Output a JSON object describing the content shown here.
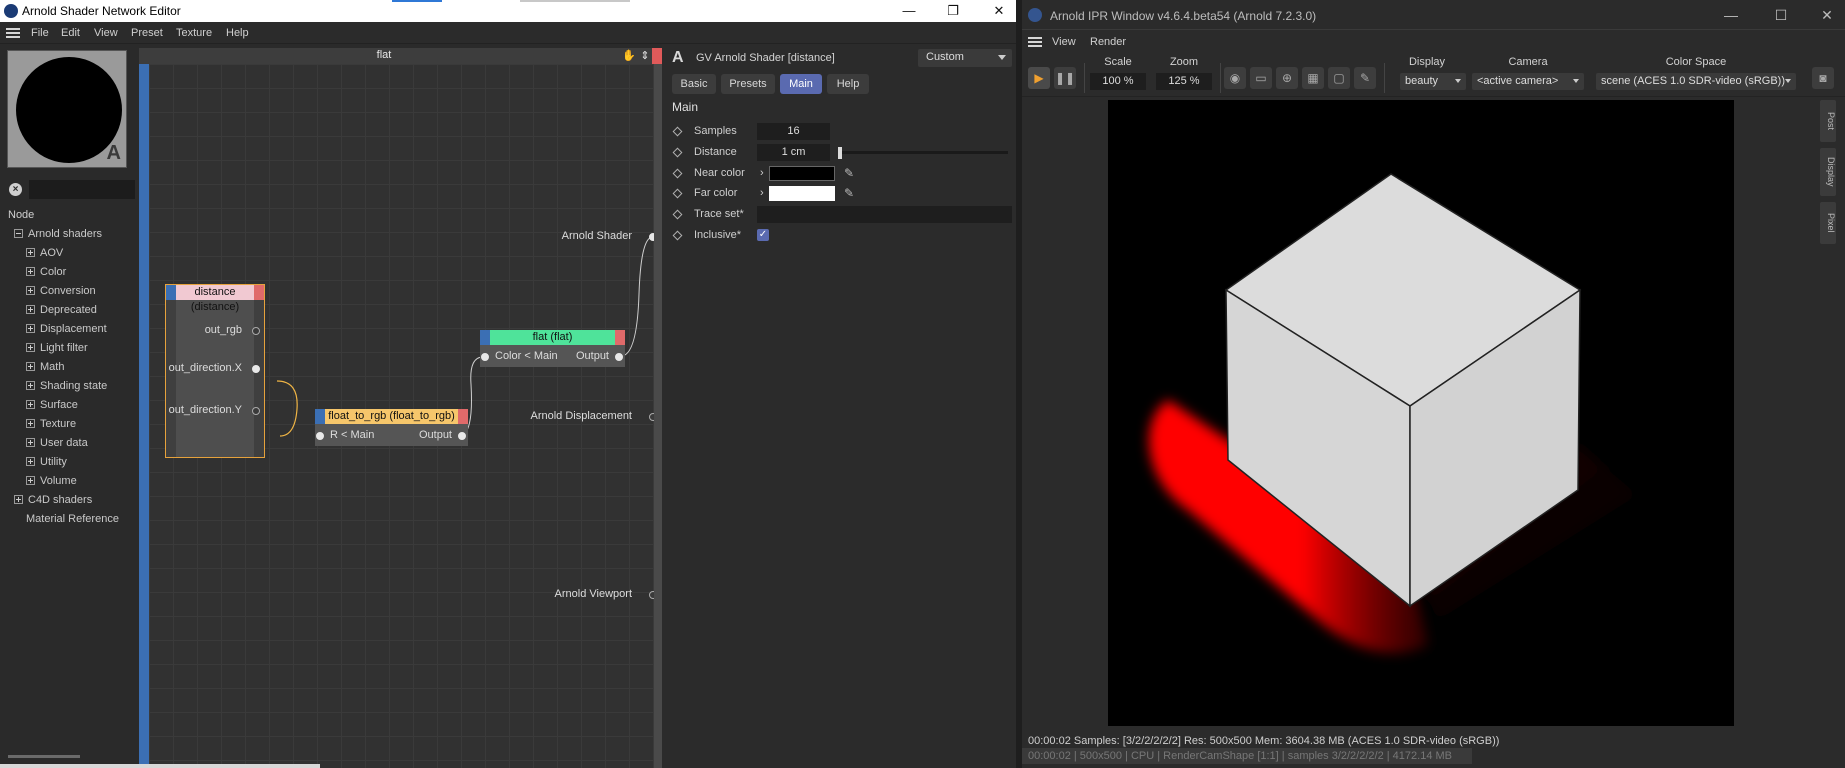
{
  "left_window": {
    "title": "Arnold Shader Network Editor",
    "menu": [
      "File",
      "Edit",
      "View",
      "Preset",
      "Texture",
      "Help"
    ],
    "preview_badge": "A",
    "search": {
      "value": "",
      "placeholder": ""
    },
    "tree_header": "Node",
    "tree": {
      "root": "Arnold shaders",
      "children": [
        "AOV",
        "Color",
        "Conversion",
        "Deprecated",
        "Displacement",
        "Light filter",
        "Math",
        "Shading state",
        "Surface",
        "Texture",
        "User data",
        "Utility",
        "Volume"
      ],
      "c4d": "C4D shaders",
      "material_ref": "Material Reference"
    },
    "graph": {
      "title": "flat",
      "nodes": {
        "distance": {
          "title": "distance (distance)",
          "ports": [
            "out_rgb",
            "out_direction.X",
            "out_direction.Y"
          ]
        },
        "float_to_rgb": {
          "title": "float_to_rgb (float_to_rgb)",
          "in": "R < Main",
          "out": "Output"
        },
        "flat": {
          "title": "flat (flat)",
          "in": "Color < Main",
          "out": "Output"
        }
      },
      "outputs": [
        "Arnold Shader",
        "Arnold Displacement",
        "Arnold Viewport"
      ]
    },
    "attributes": {
      "logo": "A",
      "title": "GV Arnold Shader [distance]",
      "preset": "Custom",
      "tabs": [
        "Basic",
        "Presets",
        "Main",
        "Help"
      ],
      "active_tab": "Main",
      "section": "Main",
      "samples_label": "Samples",
      "samples_value": "16",
      "distance_label": "Distance",
      "distance_value": "1 cm",
      "near_color_label": "Near color",
      "far_color_label": "Far color",
      "trace_set_label": "Trace set*",
      "inclusive_label": "Inclusive*",
      "inclusive_checked": true,
      "near_color": "#000000",
      "far_color": "#ffffff"
    }
  },
  "right_window": {
    "title": "Arnold IPR Window v4.6.4.beta54 (Arnold 7.2.3.0)",
    "menu": [
      "View",
      "Render"
    ],
    "toolbar": {
      "scale_label": "Scale",
      "scale_value": "100 %",
      "zoom_label": "Zoom",
      "zoom_value": "125 %",
      "display_label": "Display",
      "display_value": "beauty",
      "camera_label": "Camera",
      "camera_value": "<active camera>",
      "colorspace_label": "Color Space",
      "colorspace_value": "scene (ACES 1.0 SDR-video (sRGB))"
    },
    "side_tabs": [
      "Post",
      "Display",
      "Pixel"
    ],
    "status": "00:00:02  Samples: [3/2/2/2/2/2]  Res: 500x500  Mem: 3604.38 MB  (ACES 1.0 SDR-video (sRGB))",
    "status2": "00:00:02 | 500x500 | CPU | RenderCamShape [1:1] | samples 3/2/2/2/2/2 | 4172.14 MB"
  },
  "colors": {
    "accent_blue": "#5a6ab0",
    "node_distance_head": "#f1c9d2",
    "node_float_head": "#f6c66b",
    "node_flat_head": "#4fe39a",
    "render_red": "#ff0000",
    "cube": "#d7d7d7"
  }
}
